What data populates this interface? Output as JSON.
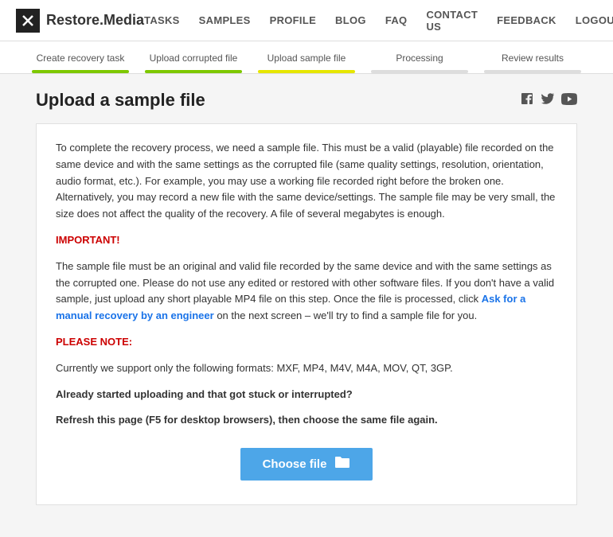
{
  "header": {
    "logo_text": "Restore.Media",
    "logo_icon": "X",
    "nav_items": [
      {
        "label": "TASKS",
        "href": "#"
      },
      {
        "label": "SAMPLES",
        "href": "#"
      },
      {
        "label": "PROFILE",
        "href": "#"
      },
      {
        "label": "BLOG",
        "href": "#"
      },
      {
        "label": "FAQ",
        "href": "#"
      },
      {
        "label": "CONTACT US",
        "href": "#"
      },
      {
        "label": "FEEDBACK",
        "href": "#"
      },
      {
        "label": "LOGOUT",
        "href": "#"
      }
    ]
  },
  "steps": [
    {
      "label": "Create recovery task",
      "bar": "green"
    },
    {
      "label": "Upload corrupted file",
      "bar": "green"
    },
    {
      "label": "Upload sample file",
      "bar": "yellow"
    },
    {
      "label": "Processing",
      "bar": "gray"
    },
    {
      "label": "Review results",
      "bar": "gray"
    }
  ],
  "page": {
    "title": "Upload a sample file",
    "description1": "To complete the recovery process, we need a sample file. This must be a valid (playable) file recorded on the same device and with the same settings as the corrupted file (same quality settings, resolution, orientation, audio format, etc.). For example, you may use a working file recorded right before the broken one. Alternatively, you may record a new file with the same device/settings. The sample file may be very small, the size does not affect the quality of the recovery. A file of several megabytes is enough.",
    "important_label": "IMPORTANT!",
    "important_text_before": "The sample file must be an original and valid file recorded by the same device and with the same settings as the corrupted one. Please do not use any edited or restored with other software files. If you don’t have a valid sample, just upload any short playable MP4 file on this step. Once the file is processed, click ",
    "important_link": "Ask for a manual recovery by an engineer",
    "important_text_after": " on the next screen – we’ll try to find a sample file for you.",
    "please_note_label": "PLEASE NOTE:",
    "please_note_text": "Currently we support only the following formats: MXF, MP4, M4V, M4A, MOV, QT, 3GP.",
    "bold_note_line1": "Already started uploading and that got stuck or interrupted?",
    "bold_note_line2": "Refresh this page (F5 for desktop browsers), then choose the same file again.",
    "choose_file_btn": "Choose file"
  }
}
